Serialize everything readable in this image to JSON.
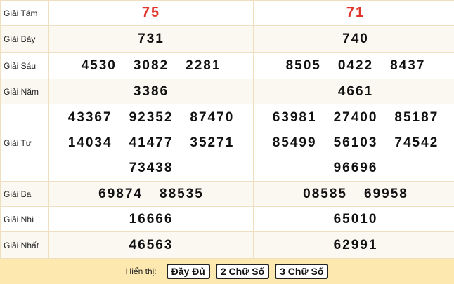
{
  "prizes": {
    "tam": {
      "label": "Giải Tám",
      "left": [
        "75"
      ],
      "right": [
        "71"
      ]
    },
    "bay": {
      "label": "Giải Bảy",
      "left": [
        "731"
      ],
      "right": [
        "740"
      ]
    },
    "sau": {
      "label": "Giải Sáu",
      "left": [
        "4530",
        "3082",
        "2281"
      ],
      "right": [
        "8505",
        "0422",
        "8437"
      ]
    },
    "nam": {
      "label": "Giải Năm",
      "left": [
        "3386"
      ],
      "right": [
        "4661"
      ]
    },
    "tu": {
      "label": "Giải Tư",
      "left": [
        "43367",
        "92352",
        "87470",
        "14034",
        "41477",
        "35271",
        "73438"
      ],
      "right": [
        "63981",
        "27400",
        "85187",
        "85499",
        "56103",
        "74542",
        "96696"
      ]
    },
    "ba": {
      "label": "Giải Ba",
      "left": [
        "69874",
        "88535"
      ],
      "right": [
        "08585",
        "69958"
      ]
    },
    "nhi": {
      "label": "Giải Nhì",
      "left": [
        "16666"
      ],
      "right": [
        "65010"
      ]
    },
    "nhat": {
      "label": "Giải Nhất",
      "left": [
        "46563"
      ],
      "right": [
        "62991"
      ]
    }
  },
  "footer": {
    "label": "Hiển thị:",
    "buttons": [
      "Đầy Đủ",
      "2 Chữ Số",
      "3 Chữ Số"
    ]
  },
  "colors": {
    "special_prize": "#e0332a",
    "footer_bg": "#fde8b0",
    "border": "#eedfc0"
  }
}
